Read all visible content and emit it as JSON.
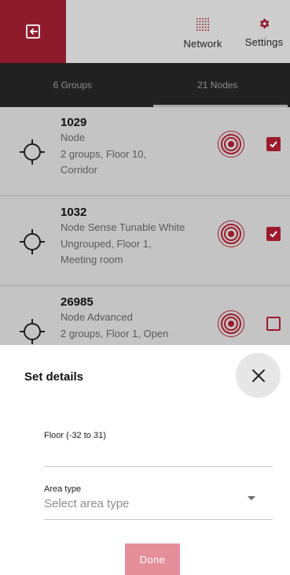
{
  "header": {
    "network_label": "Network",
    "settings_label": "Settings"
  },
  "tabs": [
    {
      "label": "6 Groups",
      "active": false
    },
    {
      "label": "21 Nodes",
      "active": true
    }
  ],
  "nodes": [
    {
      "name": "1029",
      "lines": [
        "Node",
        "2 groups, Floor 10,",
        "Corridor"
      ],
      "checked": true
    },
    {
      "name": "1032",
      "lines": [
        "Node Sense Tunable White",
        "Ungrouped, Floor 1,",
        "Meeting room"
      ],
      "checked": true
    },
    {
      "name": "26985",
      "lines": [
        "Node Advanced",
        "2 groups, Floor 1, Open"
      ],
      "checked": false
    }
  ],
  "sheet": {
    "title": "Set details",
    "floor_label": "Floor (-32 to 31)",
    "area_label": "Area type",
    "area_placeholder": "Select area type",
    "done_label": "Done"
  },
  "colors": {
    "accent": "#9e1b2d",
    "exit_bg": "#8e1b2b",
    "tabs_bg": "#212121",
    "overlay": "#c4c4c4",
    "done_disabled": "#e58f9b"
  }
}
